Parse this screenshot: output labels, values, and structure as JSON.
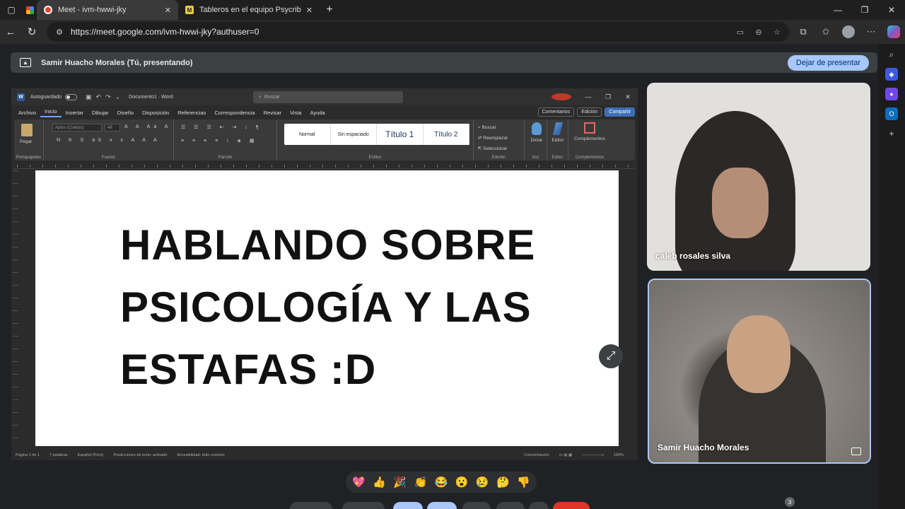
{
  "browser": {
    "tabs": [
      {
        "title": "Meet - ivm-hwwi-jky",
        "active": true
      },
      {
        "title": "Tableros en el equipo Psycrib - Mi",
        "active": false
      }
    ],
    "url": "https://meet.google.com/ivm-hwwi-jky?authuser=0"
  },
  "meet": {
    "presenting_label": "Samir Huacho Morales (Tú, presentando)",
    "stop_presenting": "Dejar de presentar",
    "participants": [
      {
        "name": "caleb rosales silva"
      },
      {
        "name": "Samir Huacho Morales"
      }
    ],
    "reactions": [
      "💖",
      "👍",
      "🎉",
      "👏",
      "😂",
      "😮",
      "😢",
      "🤔",
      "👎"
    ],
    "badge": "3"
  },
  "word": {
    "autosave": "Autoguardado",
    "doc_title": "Documento1 · Word",
    "search_placeholder": "Buscar",
    "tabs": [
      "Archivo",
      "Inicio",
      "Insertar",
      "Dibujar",
      "Diseño",
      "Disposición",
      "Referencias",
      "Correspondencia",
      "Revisar",
      "Vista",
      "Ayuda"
    ],
    "right_buttons": {
      "comments": "Comentarios",
      "editing": "Edición",
      "share": "Compartir"
    },
    "ribbon": {
      "paste": "Pegar",
      "clipboard": "Portapapeles",
      "font_name": "Aptos (Cuerpo)",
      "font_size": "48",
      "font_group": "Fuente",
      "paragraph_group": "Párrafo",
      "styles": [
        "Normal",
        "Sin espaciado",
        "Título 1",
        "Título 2"
      ],
      "styles_group": "Estilos",
      "edit_cmds": [
        "Buscar",
        "Reemplazar",
        "Seleccionar"
      ],
      "edit_group": "Edición",
      "dictate": "Dictar",
      "voice_group": "Voz",
      "editor": "Editor",
      "editor_group": "Editor",
      "addins": "Complementos",
      "addins_group": "Complementos"
    },
    "document_lines": [
      "HABLANDO SOBRE",
      "PSICOLOGÍA Y LAS",
      "ESTAFAS :D"
    ],
    "status": {
      "page": "Página 1 de 1",
      "words": "7 palabras",
      "language": "Español (Perú)",
      "predictions": "Predicciones de texto: activado",
      "accessibility": "Accesibilidad: todo correcto",
      "focus": "Concentración",
      "zoom": "160%"
    }
  }
}
